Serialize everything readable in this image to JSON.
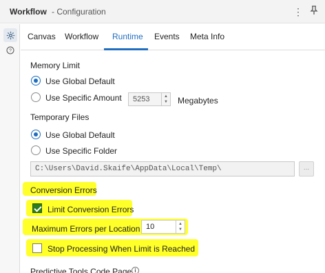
{
  "window": {
    "title": "Workflow",
    "subtitle": "- Configuration",
    "menu_icon": "vertical-ellipsis-icon",
    "pin_icon": "pin-icon"
  },
  "sidebar": {
    "items": [
      {
        "icon": "gear-icon",
        "active": true
      },
      {
        "icon": "help-icon",
        "active": false
      }
    ]
  },
  "tabs": [
    {
      "label": "Canvas"
    },
    {
      "label": "Workflow"
    },
    {
      "label": "Runtime",
      "active": true
    },
    {
      "label": "Events"
    },
    {
      "label": "Meta Info"
    }
  ],
  "memory_limit": {
    "title": "Memory Limit",
    "use_global_label": "Use Global Default",
    "use_specific_label": "Use Specific Amount",
    "amount": "5253",
    "unit": "Megabytes",
    "selected": "global"
  },
  "temporary_files": {
    "title": "Temporary Files",
    "use_global_label": "Use Global Default",
    "use_specific_label": "Use Specific Folder",
    "path": "C:\\Users\\David.Skaife\\AppData\\Local\\Temp\\",
    "browse_label": "...",
    "selected": "global"
  },
  "conversion_errors": {
    "title": "Conversion Errors",
    "limit_label": "Limit Conversion Errors",
    "limit_checked": true,
    "max_label": "Maximum Errors per Location",
    "max_value": "10",
    "stop_label": "Stop Processing When Limit is Reached",
    "stop_checked": false
  },
  "predictive": {
    "title": "Predictive Tools Code Page",
    "info_icon": "info-icon"
  },
  "colors": {
    "accent": "#1f6dbf",
    "highlight": "#ffff2a",
    "checkbox_green": "#2e7d1f"
  }
}
